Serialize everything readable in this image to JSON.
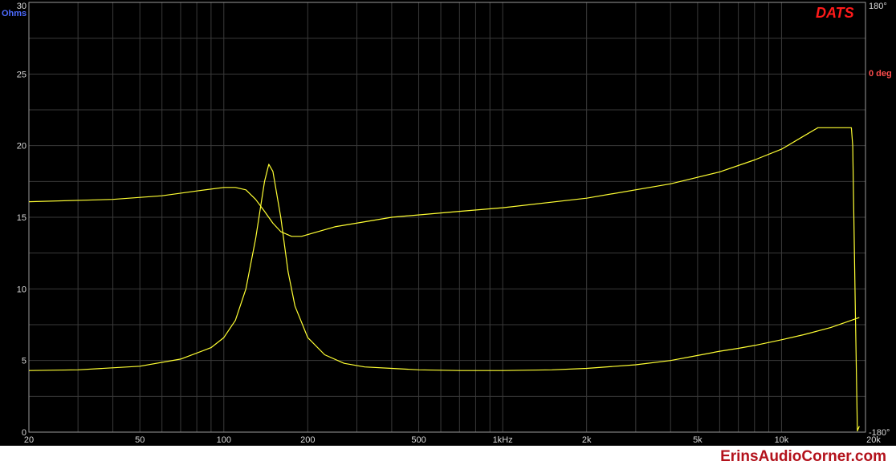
{
  "watermark": "ErinsAudioCorner.com",
  "brand": "DATS",
  "chart_data": {
    "type": "line",
    "xscale": "log",
    "xlim": [
      20,
      20000
    ],
    "ylim": [
      0,
      30
    ],
    "y2lim": [
      -180,
      180
    ],
    "ylabel": "Ohms",
    "y2label": "0 deg",
    "grid": true,
    "x_ticks": [
      {
        "v": 20,
        "label": "20"
      },
      {
        "v": 50,
        "label": "50"
      },
      {
        "v": 100,
        "label": "100"
      },
      {
        "v": 200,
        "label": "200"
      },
      {
        "v": 500,
        "label": "500"
      },
      {
        "v": 1000,
        "label": "1kHz"
      },
      {
        "v": 2000,
        "label": "2k"
      },
      {
        "v": 5000,
        "label": "5k"
      },
      {
        "v": 10000,
        "label": "10k"
      },
      {
        "v": 20000,
        "label": "20k"
      }
    ],
    "y_ticks": [
      "0",
      "5",
      "10",
      "15",
      "20",
      "25",
      "30"
    ],
    "y2_ticks": [
      {
        "v": 180,
        "label": "180°"
      },
      {
        "v": -180,
        "label": "-180°"
      }
    ],
    "colors": {
      "curve": "#ffff33",
      "background": "#000000",
      "grid": "#3a3a3a",
      "ylabel": "#4d6bff",
      "y2label": "#ff4d4d"
    },
    "series": [
      {
        "id": "impedance",
        "axis": "left",
        "x": [
          20,
          30,
          50,
          70,
          90,
          100,
          110,
          120,
          130,
          140,
          145,
          150,
          160,
          170,
          180,
          200,
          230,
          270,
          320,
          400,
          500,
          700,
          1000,
          1500,
          2000,
          3000,
          4000,
          5000,
          6000,
          7000,
          8000,
          10000,
          12000,
          15000,
          19000
        ],
        "y": [
          4.3,
          4.35,
          4.6,
          5.1,
          5.9,
          6.6,
          7.8,
          10.0,
          13.5,
          17.5,
          18.7,
          18.2,
          15.0,
          11.2,
          8.8,
          6.6,
          5.4,
          4.8,
          4.55,
          4.45,
          4.35,
          4.3,
          4.3,
          4.35,
          4.45,
          4.7,
          5.0,
          5.35,
          5.65,
          5.85,
          6.05,
          6.45,
          6.8,
          7.3,
          8.0
        ]
      },
      {
        "id": "phase",
        "axis": "right",
        "x": [
          20,
          40,
          60,
          80,
          100,
          110,
          120,
          130,
          140,
          150,
          160,
          175,
          190,
          250,
          400,
          700,
          1000,
          2000,
          4000,
          6000,
          8000,
          10000,
          12000,
          13500,
          17800,
          18000,
          18400,
          18700,
          19000
        ],
        "y": [
          13,
          15,
          18,
          22,
          25,
          25,
          23,
          15,
          5,
          -5,
          -12,
          -16,
          -16,
          -8,
          0,
          5,
          8,
          16,
          28,
          38,
          48,
          57,
          68,
          75,
          75,
          60,
          -80,
          -179,
          -175
        ]
      }
    ]
  }
}
